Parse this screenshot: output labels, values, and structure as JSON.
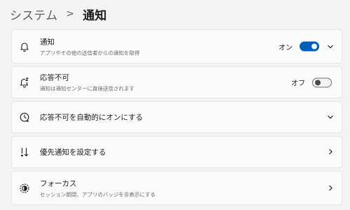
{
  "breadcrumb": {
    "parent": "システム",
    "separator": ">",
    "current": "通知"
  },
  "settings": [
    {
      "title": "通知",
      "subtitle": "アプリやその他の送信者からの通知を取得",
      "toggle_label": "オン",
      "toggle_state": "on",
      "icon": "bell-icon",
      "chevron": "chevron-down-icon"
    },
    {
      "title": "応答不可",
      "subtitle": "通知は通知センターに直接送信されます",
      "toggle_label": "オフ",
      "toggle_state": "off",
      "icon": "bell-snooze-icon"
    },
    {
      "title": "応答不可を自動的にオンにする",
      "icon": "clock-icon",
      "chevron": "chevron-down-icon"
    },
    {
      "title": "優先通知を設定する",
      "icon": "priority-sort-icon",
      "chevron": "chevron-right-icon"
    },
    {
      "title": "フォーカス",
      "subtitle": "セッション期間、アプリのバッジを非表示にする",
      "icon": "focus-icon",
      "chevron": "chevron-right-icon"
    }
  ],
  "colors": {
    "accent": "#005fb8",
    "background": "#f3f3f3",
    "card": "#fbfbfb"
  }
}
